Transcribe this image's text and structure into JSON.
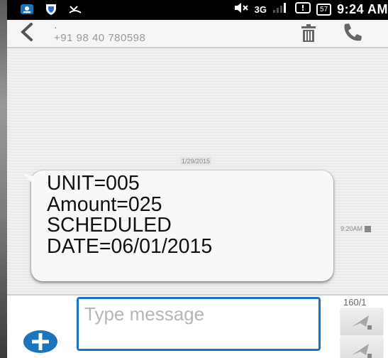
{
  "status_bar": {
    "network": "3G",
    "battery": "57",
    "time": "9:24 AM"
  },
  "header": {
    "contact_name": "·",
    "contact_number": "+91 98 40 780598"
  },
  "conversation": {
    "date": "1/29/2015",
    "message_text": "UNIT=005\nAmount=025\nSCHEDULED\nDATE=06/01/2015",
    "message_time": "9:20AM"
  },
  "compose": {
    "placeholder": "Type message",
    "char_counter": "160/1"
  },
  "icons": {
    "back": "back-arrow-icon",
    "delete": "trash-icon",
    "call": "phone-icon",
    "attach": "add-icon",
    "send": "send-icon"
  },
  "colors": {
    "accent": "#1c74bd",
    "status_bar": "#000000",
    "bubble": "#f8f8f8"
  }
}
